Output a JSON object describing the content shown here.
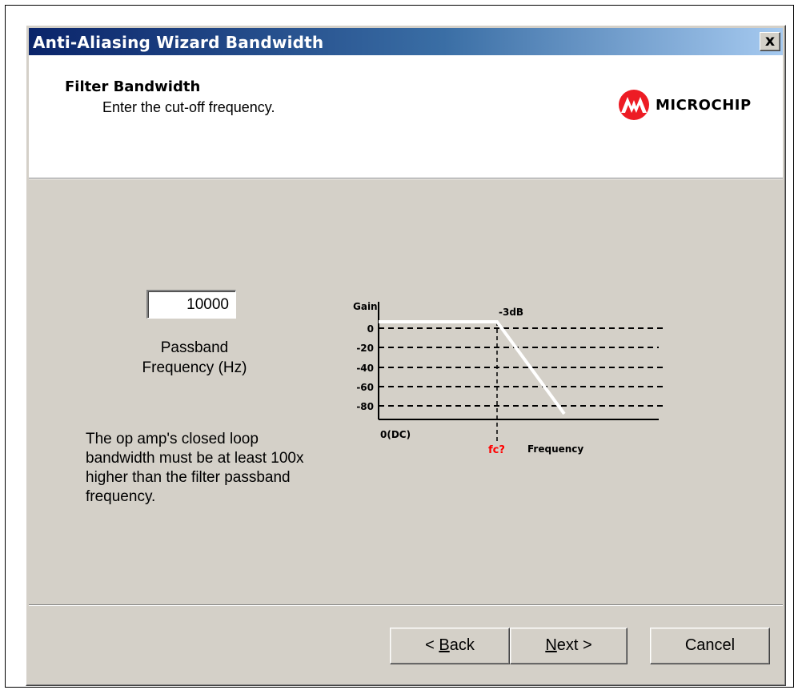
{
  "window": {
    "title": "Anti-Aliasing Wizard Bandwidth",
    "close_glyph": "x"
  },
  "header": {
    "title": "Filter Bandwidth",
    "subtitle": "Enter the cut-off frequency.",
    "logo_text": "Microchip",
    "logo_color": "#ed1c24"
  },
  "form": {
    "passband_value": "10000",
    "passband_label_line1": "Passband",
    "passband_label_line2": "Frequency (Hz)",
    "note": "The op amp's closed loop bandwidth must be at least 100x higher than the filter passband frequency."
  },
  "diagram": {
    "y_axis_label": "Gain",
    "x_axis_label": "Frequency",
    "origin_label": "0(DC)",
    "cutoff_label": "-3dB",
    "fc_label": "fc?",
    "fc_color": "#ff0000",
    "gain_ticks": [
      "0",
      "-20",
      "-40",
      "-60",
      "-80"
    ],
    "response_color": "#ffffff"
  },
  "buttons": {
    "back": {
      "prefix": "< ",
      "accel": "B",
      "rest": "ack"
    },
    "next": {
      "accel": "N",
      "rest": "ext >"
    },
    "cancel": "Cancel"
  }
}
